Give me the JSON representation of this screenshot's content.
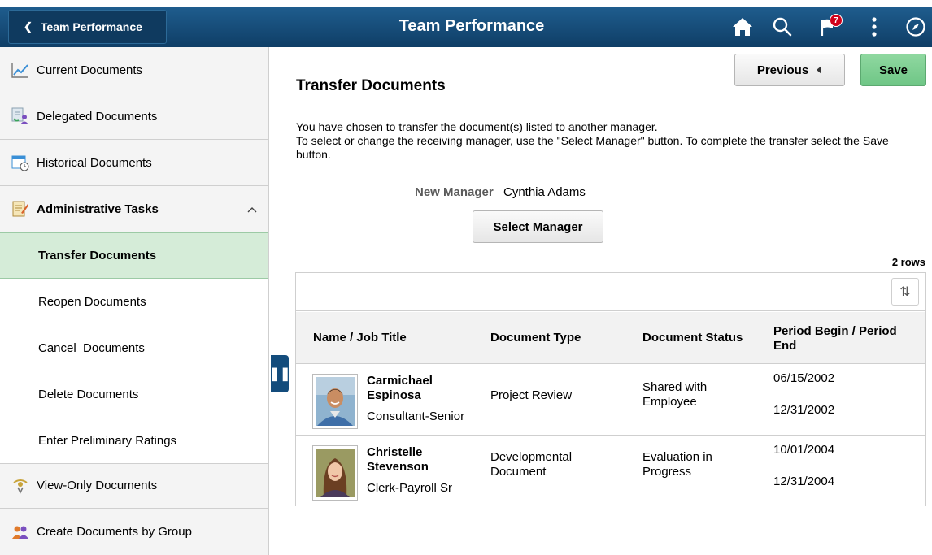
{
  "header": {
    "back_label": "Team Performance",
    "title": "Team Performance",
    "notification_count": "7",
    "icons": [
      "home-icon",
      "search-icon",
      "notifications-icon",
      "actions-menu-icon",
      "navbar-icon"
    ]
  },
  "sidebar": {
    "items": [
      {
        "label": "Current Documents",
        "icon": "chart-icon"
      },
      {
        "label": "Delegated Documents",
        "icon": "delegated-icon"
      },
      {
        "label": "Historical Documents",
        "icon": "calendar-clock-icon"
      },
      {
        "label": "Administrative Tasks",
        "icon": "notepad-icon"
      },
      {
        "label": "View-Only Documents",
        "icon": "view-only-icon"
      },
      {
        "label": "Create Documents by Group",
        "icon": "group-icon"
      }
    ],
    "sub_items": [
      "Transfer Documents",
      "Reopen Documents",
      "Cancel  Documents",
      "Delete Documents",
      "Enter Preliminary Ratings"
    ]
  },
  "main": {
    "title": "Transfer Documents",
    "previous_label": "Previous",
    "save_label": "Save",
    "instructions_line1": "You have chosen to transfer the document(s) listed to another manager.",
    "instructions_line2": "To select or change the receiving manager, use the \"Select Manager\" button. To complete the transfer select the Save button.",
    "new_manager_label": "New Manager",
    "new_manager_value": "Cynthia Adams",
    "select_manager_label": "Select Manager",
    "rows_count": "2 rows"
  },
  "grid": {
    "headers": [
      "Name / Job Title",
      "Document Type",
      "Document Status",
      "Period Begin / Period End"
    ],
    "rows": [
      {
        "name": "Carmichael Espinosa",
        "job_title": "Consultant-Senior",
        "document_type": "Project Review",
        "document_status": "Shared with Employee",
        "period_begin": "06/15/2002",
        "period_end": "12/31/2002"
      },
      {
        "name": "Christelle Stevenson",
        "job_title": "Clerk-Payroll Sr",
        "document_type": "Developmental Document",
        "document_status": "Evaluation in Progress",
        "period_begin": "10/01/2004",
        "period_end": "12/31/2004"
      }
    ]
  },
  "colors": {
    "header_bg": "#1a5283",
    "active_item_bg": "#d5ecd8",
    "save_button_bg": "#7fd095"
  }
}
